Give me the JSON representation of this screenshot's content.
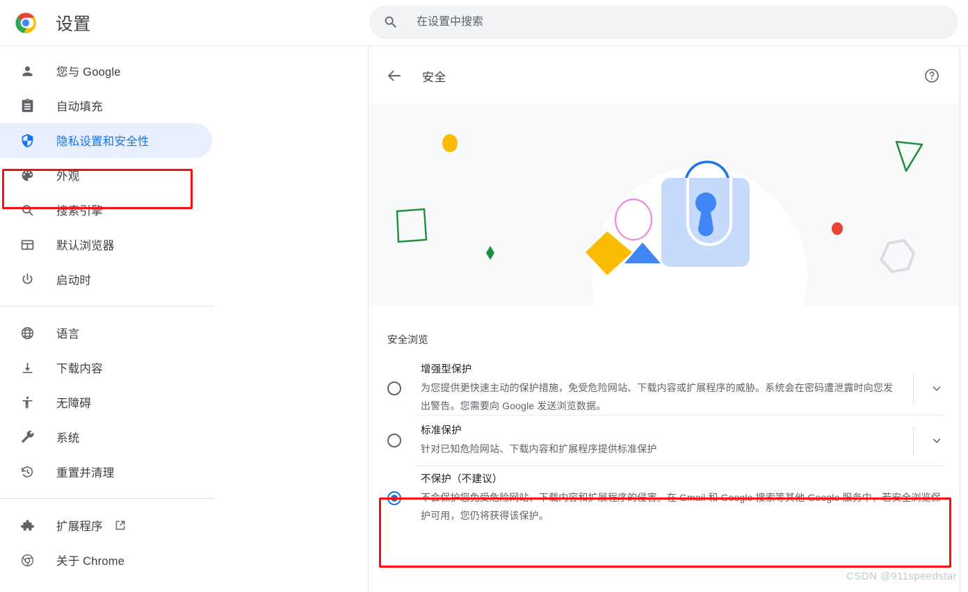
{
  "app": {
    "title": "设置",
    "logo_icon": "chrome-logo-icon"
  },
  "search": {
    "placeholder": "在设置中搜索",
    "value": "",
    "icon": "search-icon"
  },
  "sidebar": {
    "groups": [
      {
        "items": [
          {
            "label": "您与 Google",
            "icon": "person-icon",
            "selected": false
          },
          {
            "label": "自动填充",
            "icon": "clipboard-icon",
            "selected": false
          },
          {
            "label": "隐私设置和安全性",
            "icon": "shield-icon",
            "selected": true
          },
          {
            "label": "外观",
            "icon": "palette-icon",
            "selected": false
          },
          {
            "label": "搜索引擎",
            "icon": "search-icon",
            "selected": false
          },
          {
            "label": "默认浏览器",
            "icon": "browser-window-icon",
            "selected": false
          },
          {
            "label": "启动时",
            "icon": "power-icon",
            "selected": false
          }
        ]
      },
      {
        "items": [
          {
            "label": "语言",
            "icon": "globe-icon",
            "selected": false
          },
          {
            "label": "下载内容",
            "icon": "download-icon",
            "selected": false
          },
          {
            "label": "无障碍",
            "icon": "accessibility-icon",
            "selected": false
          },
          {
            "label": "系统",
            "icon": "wrench-icon",
            "selected": false
          },
          {
            "label": "重置并清理",
            "icon": "history-restore-icon",
            "selected": false
          }
        ]
      },
      {
        "items": [
          {
            "label": "扩展程序",
            "icon": "puzzle-icon",
            "external": true,
            "external_icon": "open-in-new-icon",
            "selected": false
          },
          {
            "label": "关于 Chrome",
            "icon": "chrome-icon",
            "selected": false
          }
        ]
      }
    ]
  },
  "main": {
    "back_icon": "back-arrow-icon",
    "page_title": "安全",
    "help_icon": "help-circle-icon",
    "hero": {
      "illustration": "security-lock-illustration",
      "background": "#f8f9fa"
    },
    "section_title": "安全浏览",
    "options": [
      {
        "name": "增强型保护",
        "description": "为您提供更快速主动的保护措施，免受危险网站、下载内容或扩展程序的威胁。系统会在密码遭泄露时向您发出警告。您需要向 Google 发送浏览数据。",
        "selected": false,
        "expand_icon": "chevron-down-icon"
      },
      {
        "name": "标准保护",
        "description": "针对已知危险网站、下载内容和扩展程序提供标准保护",
        "selected": false,
        "expand_icon": "chevron-down-icon"
      },
      {
        "name": "不保护（不建议）",
        "description": "不会保护您免受危险网站、下载内容和扩展程序的侵害。在 Gmail 和 Google 搜索等其他 Google 服务中，若安全浏览保护可用，您仍将获得该保护。",
        "selected": true,
        "expand_icon": null
      }
    ]
  },
  "annotations": {
    "color": "#fb0d0d",
    "highlight_sidebar_item": "隐私设置和安全性",
    "highlight_option": "不保护（不建议）"
  },
  "watermark": {
    "text": "CSDN @911speedstar"
  },
  "colors": {
    "accent": "#1a73e8",
    "selected_bg": "#e8f0fe",
    "text_primary": "#202124",
    "text_secondary": "#5f6368",
    "hero_bg": "#f8f9fa",
    "search_bg": "#f1f3f4"
  }
}
